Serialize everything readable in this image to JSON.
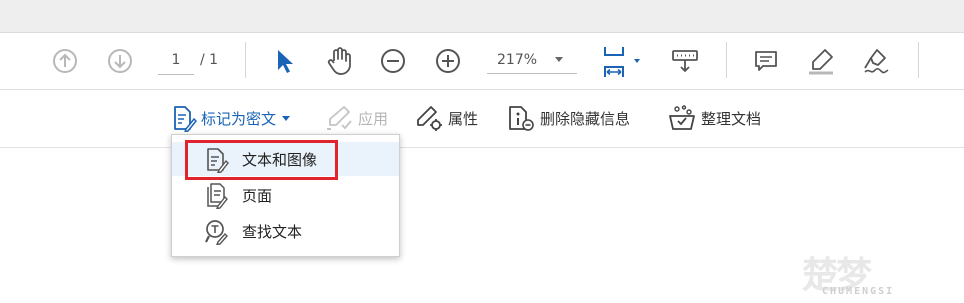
{
  "toolbar": {
    "page_current": "1",
    "page_total": "/ 1",
    "zoom": "217%"
  },
  "redact_bar": {
    "mark_for_redaction": "标记为密文",
    "apply": "应用",
    "properties": "属性",
    "remove_hidden_info": "删除隐藏信息",
    "sanitize_document": "整理文档"
  },
  "redact_menu": {
    "items": [
      {
        "label": "文本和图像",
        "icon": "redact-text-image-icon"
      },
      {
        "label": "页面",
        "icon": "redact-pages-icon"
      },
      {
        "label": "查找文本",
        "icon": "find-text-icon"
      }
    ]
  },
  "watermark": {
    "cjk": "楚梦",
    "latin": "CHUMENGSI"
  },
  "colors": {
    "accent_blue": "#1a63b5",
    "highlight_red": "#e0242f",
    "icon_gray": "#555555"
  }
}
